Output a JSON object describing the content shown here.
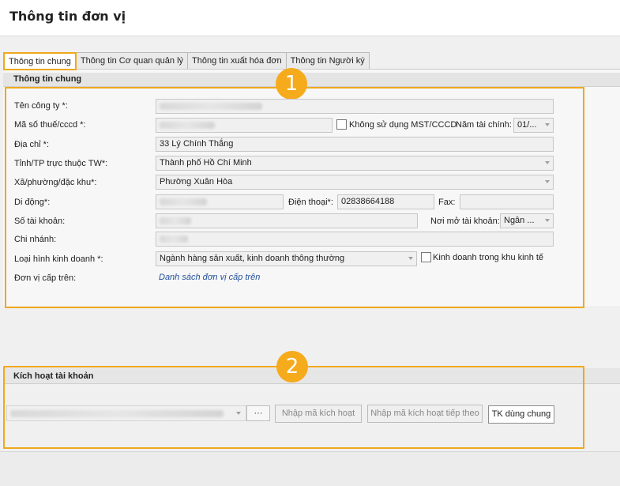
{
  "window": {
    "title": "Thông tin đơn vị"
  },
  "tabs": [
    {
      "label": "Thông tin chung"
    },
    {
      "label": "Thông tin Cơ quan quản lý"
    },
    {
      "label": "Thông tin xuất hóa đơn"
    },
    {
      "label": "Thông tin Người ký"
    }
  ],
  "general": {
    "header": "Thông tin chung",
    "badge": "1",
    "company_name_label": "Tên công ty *:",
    "tax_code_label": "Mã số thuế/cccd *:",
    "no_tax_code_checkbox": "Không sử dụng MST/CCCD",
    "fiscal_year_label": "Năm tài chính:",
    "fiscal_year_value": "01/...",
    "address_label": "Địa chỉ *:",
    "address_value": "33 Lý Chính Thắng",
    "province_label": "Tỉnh/TP trực thuộc TW*:",
    "province_value": "Thành phố Hồ Chí Minh",
    "ward_label": "Xã/phường/đặc khu*:",
    "ward_value": "Phường Xuân Hòa",
    "mobile_label": "Di động*:",
    "phone_label": "Điện thoại*:",
    "phone_value": "02838664188",
    "fax_label": "Fax:",
    "fax_value": "",
    "account_label": "Số tài khoản:",
    "bank_label": "Nơi mở tài khoản:",
    "bank_value": "Ngân ...",
    "branch_label": "Chi nhánh:",
    "business_type_label": "Loại hình kinh doanh *:",
    "business_type_value": "Ngành hàng sản xuất, kinh doanh thông thường",
    "economic_zone_checkbox": "Kinh doanh trong khu kinh tế",
    "parent_unit_label": "Đơn vị cấp trên:",
    "parent_unit_link": "Danh sách đơn vị cấp trên"
  },
  "activation": {
    "header": "Kích hoạt tài khoản",
    "badge": "2",
    "ellipsis_button": "···",
    "enter_code_button": "Nhập mã kích hoạt",
    "enter_next_code_button": "Nhập mã kích hoạt tiếp theo",
    "shared_account_button": "TK dùng chung"
  },
  "colors": {
    "highlight": "#f0a81d",
    "badge": "#f5ab1c",
    "link": "#1f4f9a"
  }
}
